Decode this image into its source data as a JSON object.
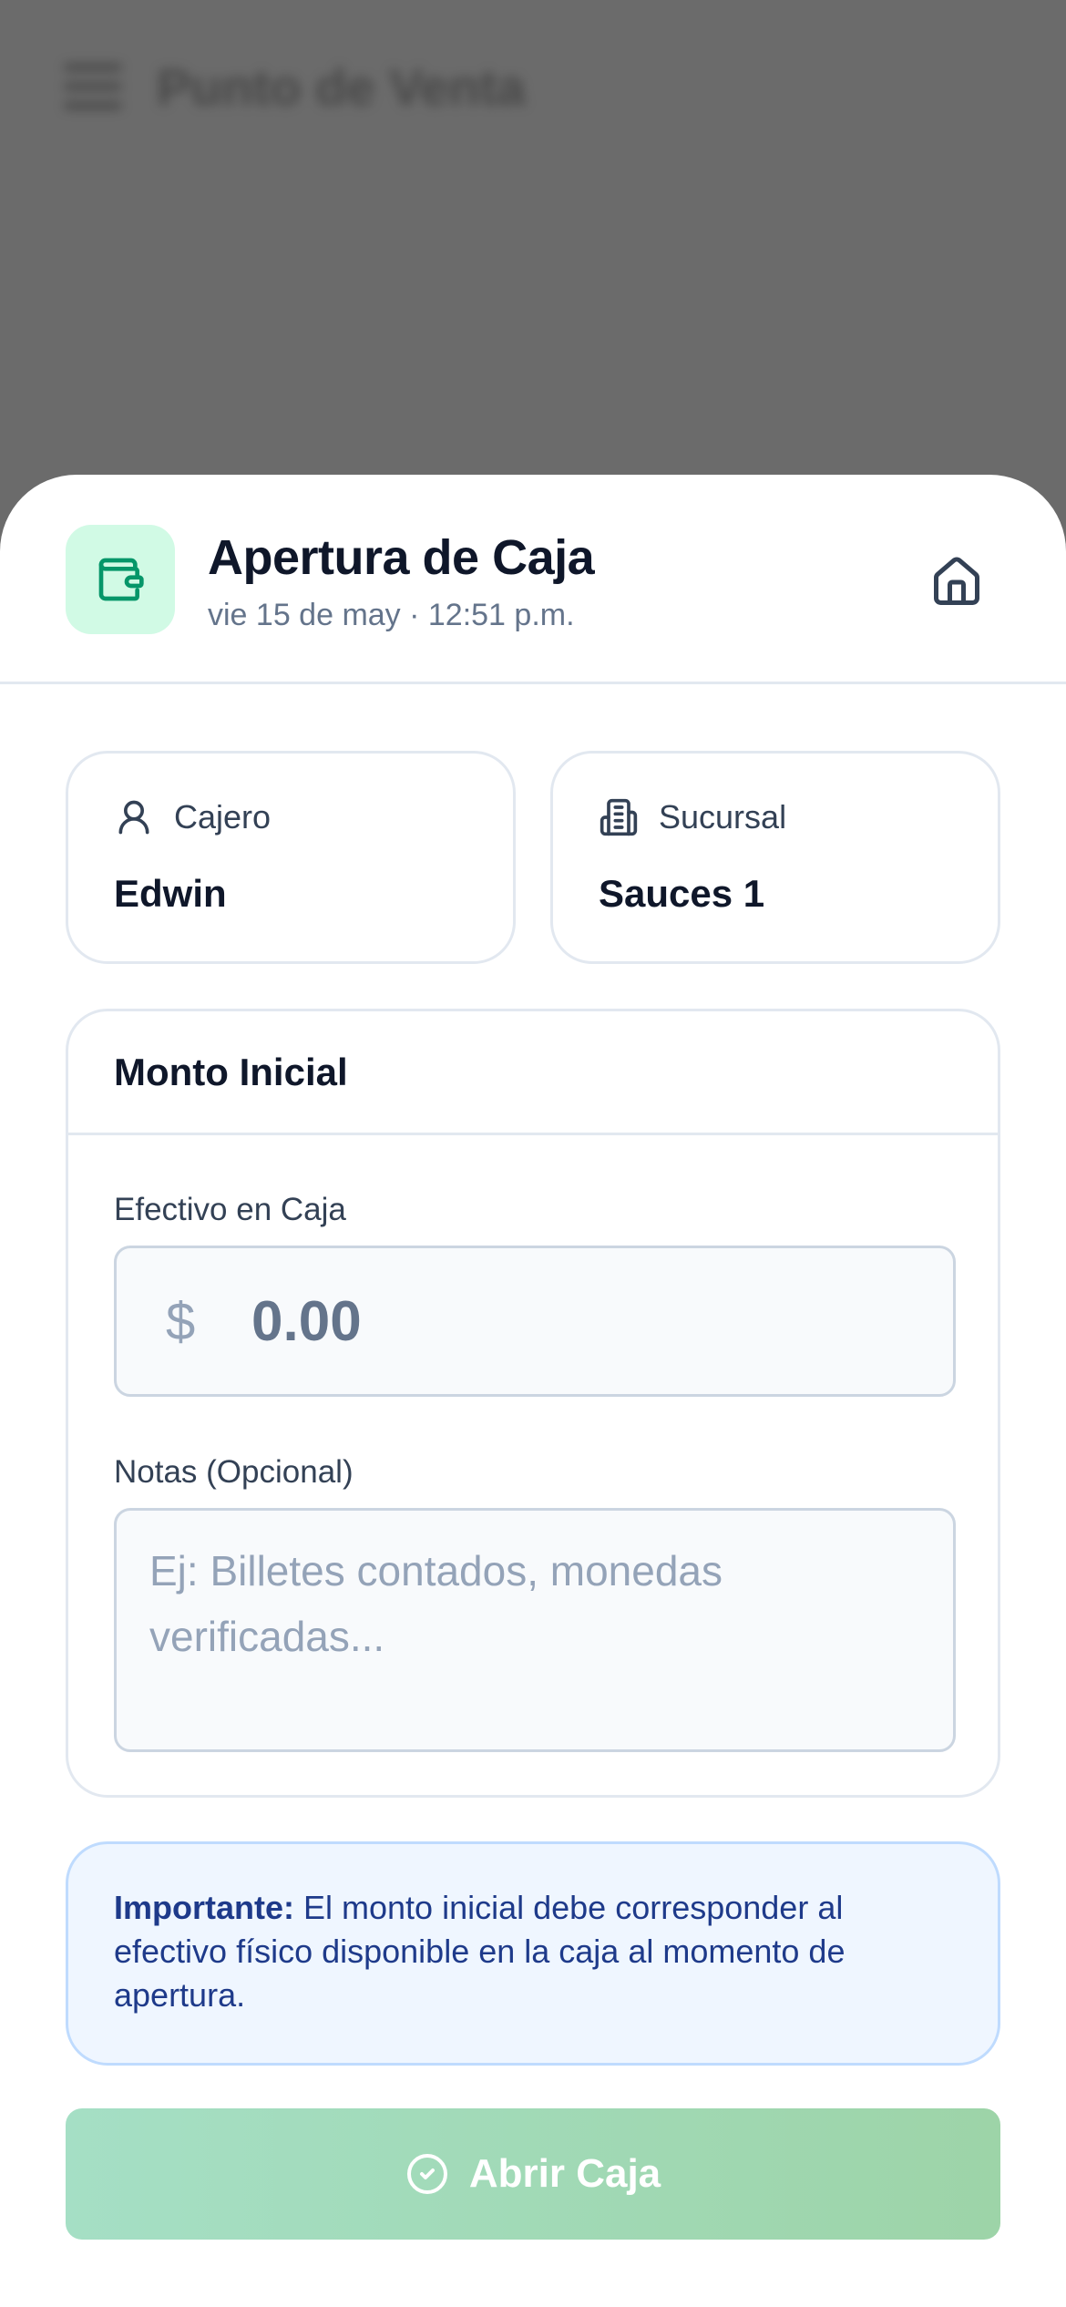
{
  "background": {
    "app_title": "Punto de Venta"
  },
  "sheet": {
    "title": "Apertura de Caja",
    "subtitle": "vie 15 de may · 12:51 p.m."
  },
  "cashier": {
    "label": "Cajero",
    "value": "Edwin"
  },
  "branch": {
    "label": "Sucursal",
    "value": "Sauces 1"
  },
  "amount": {
    "section_title": "Monto Inicial",
    "cash_label": "Efectivo en Caja",
    "currency_symbol": "$",
    "cash_placeholder": "0.00",
    "notes_label": "Notas (Opcional)",
    "notes_placeholder": "Ej: Billetes contados, monedas verificadas..."
  },
  "notice": {
    "strong": "Importante:",
    "text": " El monto inicial debe corresponder al efectivo físico disponible en la caja al momento de apertura."
  },
  "actions": {
    "open_label": "Abrir Caja"
  },
  "colors": {
    "accent_green": "#059669",
    "badge_bg": "#d1fae5",
    "notice_bg": "#eff6ff",
    "notice_text": "#1e3a8a"
  }
}
